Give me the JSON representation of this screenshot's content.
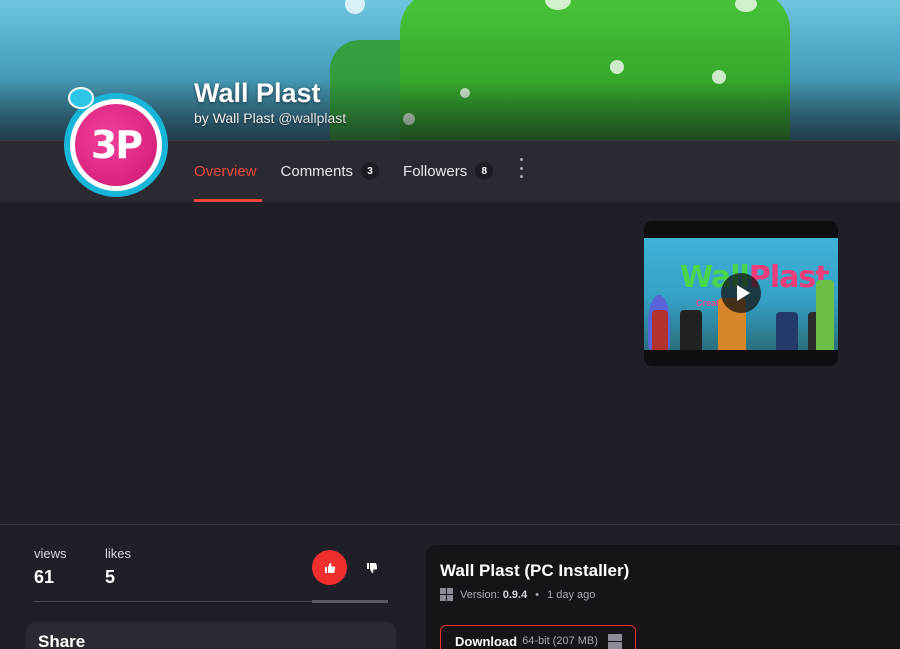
{
  "project": {
    "title": "Wall Plast",
    "by_prefix": "by",
    "author": "Wall Plast",
    "handle": "@wallplast",
    "avatar_text": "3P"
  },
  "tabs": [
    {
      "label": "Overview",
      "count": "",
      "active": true
    },
    {
      "label": "Comments",
      "count": "3",
      "active": false
    },
    {
      "label": "Followers",
      "count": "8",
      "active": false
    }
  ],
  "menu_icon": "kebab-menu-icon",
  "video": {
    "title_a": "Wall",
    "title_b": "Plast",
    "subtitle": "Creat        play",
    "play_icon": "play-icon"
  },
  "stats": {
    "views_label": "views",
    "views": "61",
    "likes_label": "likes",
    "likes": "5"
  },
  "actions": {
    "like_icon": "thumbs-up-icon",
    "dislike_icon": "thumbs-down-icon"
  },
  "share": {
    "heading": "Share"
  },
  "file": {
    "title": "Wall Plast (PC Installer)",
    "version_label": "Version:",
    "version": "0.9.4",
    "age": "1 day ago",
    "download_label": "Download",
    "download_detail": "64-bit (207 MB)",
    "platform_icon": "windows-icon"
  },
  "colors": {
    "accent": "#ef2e2e",
    "background": "#1f1f27",
    "header_bar": "#2a2a33",
    "card": "#141419"
  }
}
